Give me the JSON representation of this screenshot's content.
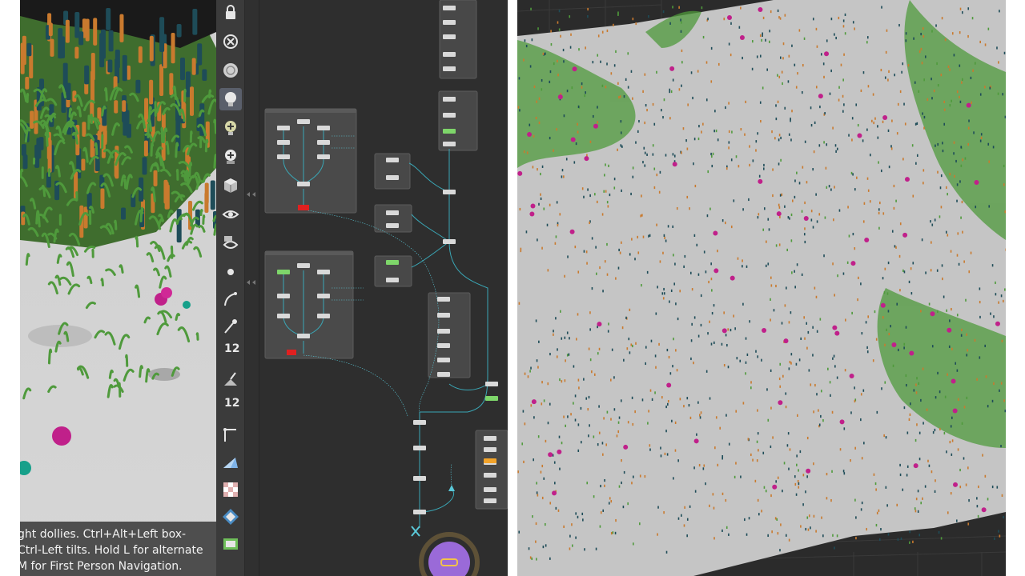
{
  "left_viewport": {
    "hint_lines": [
      "ght dollies. Ctrl+Alt+Left box-",
      "Ctrl-Left tilts. Hold L for alternate",
      "M for First Person Navigation."
    ]
  },
  "shelf": {
    "tools": [
      {
        "name": "lock-icon"
      },
      {
        "name": "ghost-icon"
      },
      {
        "name": "sphere-icon"
      },
      {
        "name": "light-bulb-icon",
        "active": true
      },
      {
        "name": "add-light-icon"
      },
      {
        "name": "add-camera-light-icon"
      },
      {
        "name": "shaded-cube-icon"
      },
      {
        "name": "visibility-icon"
      },
      {
        "name": "camera-vis-icon"
      },
      {
        "name": "point-icon"
      },
      {
        "name": "curve-icon"
      },
      {
        "name": "paint-brush-icon"
      },
      {
        "name": "point-number-icon",
        "label": "12"
      },
      {
        "name": "primitive-paint-icon"
      },
      {
        "name": "primitive-number-icon",
        "label": "12"
      },
      {
        "name": "angle-icon"
      },
      {
        "name": "triangle-plane-icon"
      },
      {
        "name": "checker-texture-icon"
      },
      {
        "name": "snap-icon"
      },
      {
        "name": "display-box-icon"
      }
    ]
  },
  "colors": {
    "ground": "#c9c9c9",
    "grass": "#4f9a3c",
    "orange": "#c97a2e",
    "teal": "#1e4c58",
    "magenta": "#c0208a",
    "network_bg": "#2e2e2e",
    "wire": "#3aa7b6",
    "flag": "#e02020",
    "output": "#9a6ad8"
  }
}
